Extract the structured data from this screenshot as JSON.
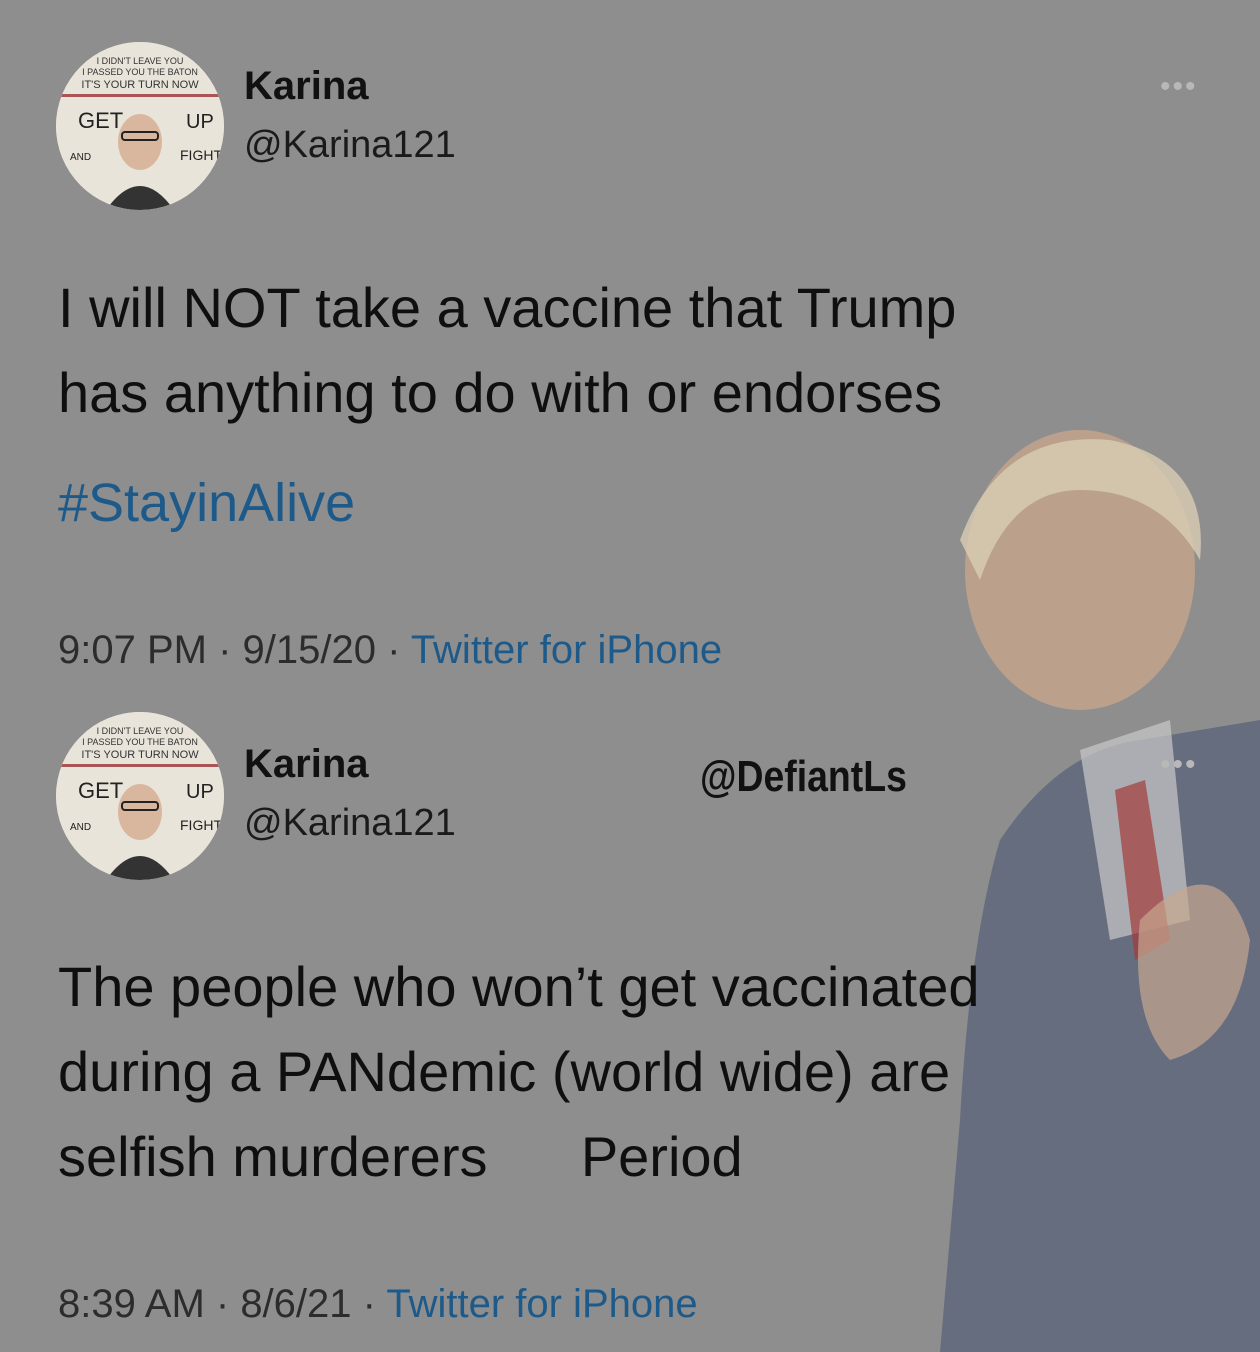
{
  "tweets": [
    {
      "name": "Karina",
      "handle": "@Karina121",
      "more": "•••",
      "text": "I will NOT take a vaccine that Trump\nhas anything to do with or endorses",
      "hashtag": "#StayinAlive",
      "time": "9:07 PM",
      "date": "9/15/20",
      "source": "Twitter for iPhone",
      "avatar_text": [
        "I DIDN'T LEAVE YOU",
        "I PASSED YOU THE BATON",
        "IT'S YOUR TURN NOW",
        "GET",
        "UP",
        "AND",
        "FIGHT"
      ]
    },
    {
      "name": "Karina",
      "handle": "@Karina121",
      "more": "•••",
      "text": "The people who won’t get vaccinated\nduring a PANdemic (world wide) are\nselfish murderers      Period",
      "time": "8:39 AM",
      "date": "8/6/21",
      "source": "Twitter for iPhone",
      "avatar_text": [
        "I DIDN'T LEAVE YOU",
        "I PASSED YOU THE BATON",
        "IT'S YOUR TURN NOW",
        "GET",
        "UP",
        "AND",
        "FIGHT"
      ]
    }
  ],
  "separator": " · ",
  "watermark": "@DefiantLs",
  "colors": {
    "background": "#8e8e8e",
    "link": "#1d5a8a",
    "text": "#0f0f0f"
  }
}
